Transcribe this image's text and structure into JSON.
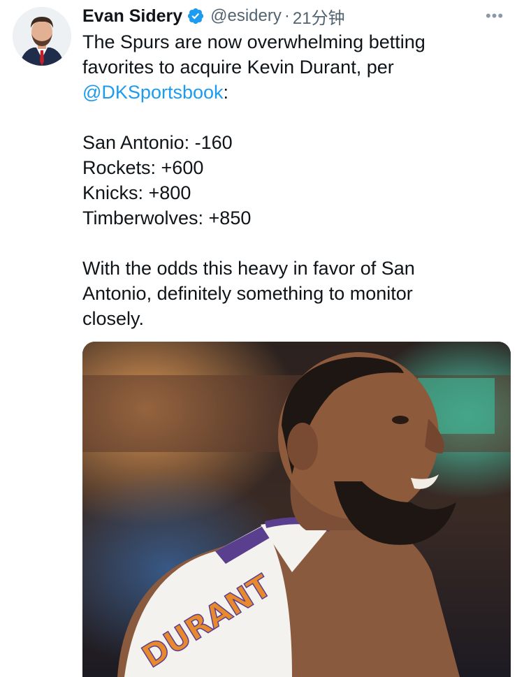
{
  "author": {
    "display_name": "Evan Sidery",
    "handle": "@esidery",
    "separator": "·",
    "timestamp": "21分钟",
    "verified": true
  },
  "more_menu": {
    "glyph": "•••"
  },
  "tweet": {
    "line1": "The Spurs are now overwhelming betting",
    "line2": "favorites to acquire Kevin Durant, per",
    "mention": "@DKSportsbook",
    "mention_suffix": ":",
    "odds": [
      "San Antonio: -160",
      "Rockets: +600",
      "Knicks: +800",
      "Timberwolves: +850"
    ],
    "closing_line1": "With the odds this heavy in favor of San",
    "closing_line2": "Antonio, definitely something to monitor",
    "closing_line3": "closely."
  },
  "media": {
    "jersey_text": "DURANT"
  },
  "colors": {
    "text": "#0f1419",
    "secondary": "#536471",
    "link": "#1d9bf0",
    "verified": "#1d9bf0"
  }
}
